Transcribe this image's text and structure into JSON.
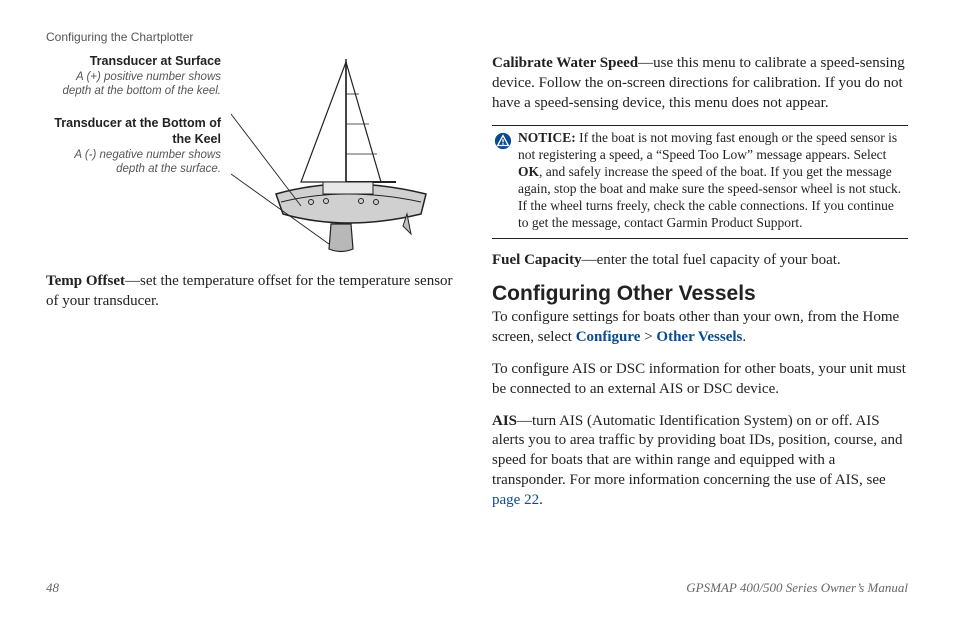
{
  "running_head": "Configuring the Chartplotter",
  "left": {
    "fig": {
      "label1_title": "Transducer at Surface",
      "label1_sub": "A (+) positive number shows depth at the bottom of the keel.",
      "label2_title": "Transducer at the Bottom of the Keel",
      "label2_sub": "A (-) negative number shows depth at the surface."
    },
    "temp_offset_head": "Temp Offset",
    "temp_offset_body": "—set the temperature offset for the temperature sensor of your transducer."
  },
  "right": {
    "calibrate_head": "Calibrate Water Speed",
    "calibrate_body": "—use this menu to calibrate a speed-sensing device. Follow the on-screen directions for calibration. If you do not have a speed-sensing device, this menu does not appear.",
    "notice_head": "NOTICE:",
    "notice_body_1": " If the boat is not moving fast enough or the speed sensor is not registering a speed, a “Speed Too Low” message appears. Select ",
    "notice_ok": "OK",
    "notice_body_2": ", and safely increase the speed of the boat. If you get the message again, stop the boat and make sure the speed-sensor wheel is not stuck. If the wheel turns freely, check the cable connections. If you continue to get the message, contact Garmin Product Support.",
    "fuel_head": "Fuel Capacity",
    "fuel_body": "—enter the total fuel capacity of your boat.",
    "section_title": "Configuring Other Vessels",
    "intro_1a": "To configure settings for boats other than your own, from the Home screen, select ",
    "intro_configure": "Configure",
    "intro_gt": " > ",
    "intro_other": "Other Vessels",
    "intro_period": ".",
    "intro_2": "To configure AIS or DSC information for other boats, your unit must be connected to an external AIS or DSC device.",
    "ais_head": "AIS",
    "ais_body_1": "—turn AIS (Automatic Identification System) on or off. AIS alerts you to area traffic by providing boat IDs, position, course, and speed for boats that are within range and equipped with a transponder. For more information concerning the use of AIS, see ",
    "ais_link": "page 22",
    "ais_period": "."
  },
  "footer": {
    "page_no": "48",
    "doc_title": "GPSMAP 400/500 Series Owner’s Manual"
  }
}
